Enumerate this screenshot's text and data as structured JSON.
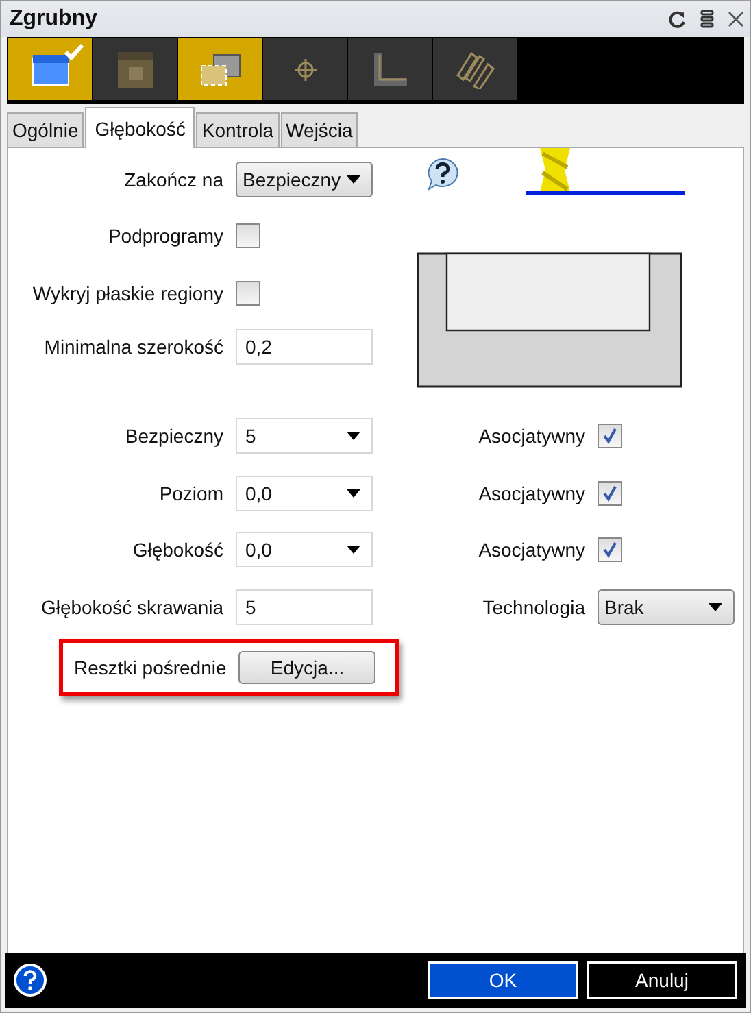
{
  "window": {
    "title": "Zgrubny"
  },
  "toolbar": [
    {
      "kind": "stock",
      "selected": true,
      "checked": true
    },
    {
      "kind": "part",
      "selected": false,
      "checked": false
    },
    {
      "kind": "boundary",
      "selected": true,
      "checked": false
    },
    {
      "kind": "point",
      "selected": false,
      "checked": false
    },
    {
      "kind": "profile",
      "selected": false,
      "checked": false
    },
    {
      "kind": "pattern",
      "selected": false,
      "checked": false
    }
  ],
  "tabs": [
    {
      "label": "Ogólnie",
      "selected": false
    },
    {
      "label": "Głębokość",
      "selected": true
    },
    {
      "label": "Kontrola",
      "selected": false
    },
    {
      "label": "Wejścia",
      "selected": false
    }
  ],
  "top_fields": [
    {
      "kind": "dropdown",
      "label": "Zakończ na",
      "value": "Bezpieczny"
    },
    {
      "kind": "checkbox",
      "label": "Podprogramy",
      "checked": false
    },
    {
      "kind": "checkbox",
      "label": "Wykryj płaskie regiony",
      "checked": false
    },
    {
      "kind": "text",
      "label": "Minimalna szerokość",
      "value": "0,2"
    }
  ],
  "levels": [
    {
      "label": "Bezpieczny",
      "kind": "combo",
      "value": "5",
      "associative_label": "Asocjatywny",
      "associative": true
    },
    {
      "label": "Poziom",
      "kind": "combo",
      "value": "0,0",
      "associative_label": "Asocjatywny",
      "associative": true
    },
    {
      "label": "Głębokość",
      "kind": "combo",
      "value": "0,0",
      "associative_label": "Asocjatywny",
      "associative": true
    },
    {
      "label": "Głębokość skrawania",
      "kind": "text",
      "value": "5",
      "side_label": "Technologia",
      "side_value": "Brak"
    }
  ],
  "intermediate_stock": {
    "label": "Resztki pośrednie",
    "button": "Edycja...",
    "highlighted": true
  },
  "footer": {
    "buttons": [
      {
        "label": "OK",
        "default": true
      },
      {
        "label": "Anuluj",
        "default": false
      }
    ]
  }
}
